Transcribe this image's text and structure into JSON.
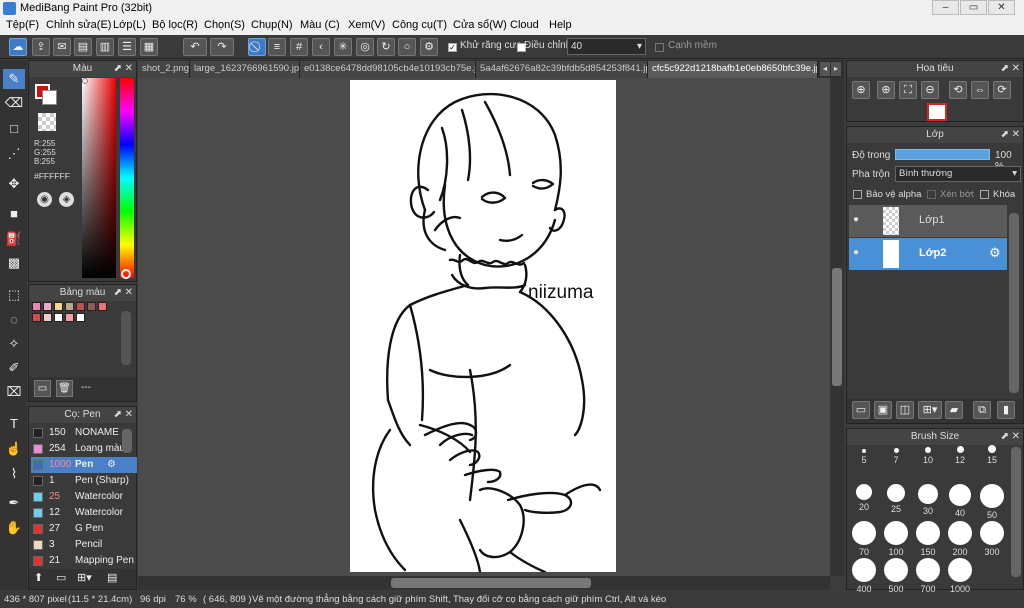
{
  "title": "MediBang Paint Pro (32bit)",
  "window_buttons": {
    "min": "–",
    "max": "▭",
    "close": "✕"
  },
  "menu": [
    "Tệp(F)",
    "Chỉnh sửa(E)",
    "Lớp(L)",
    "Bộ lọc(R)",
    "Chọn(S)",
    "Chụp(N)",
    "Màu (C)",
    "Xem(V)",
    "Công cụ(T)",
    "Cửa sổ(W)",
    "Cloud",
    "Help"
  ],
  "toolbar": {
    "antialias_label": "Khử răng cưa",
    "adjust_label": "Điều chỉnh",
    "adjust_value": "40",
    "edge_label": "Cạnh mềm"
  },
  "color_panel": {
    "title": "Màu",
    "rgb_r": "R:255",
    "rgb_g": "G:255",
    "rgb_b": "B:255",
    "hex": "#FFFFFF"
  },
  "swatch_panel": {
    "title": "Bảng màu",
    "footer": "---",
    "swatches": [
      "#e887b4",
      "#f4a6c8",
      "#f5d38a",
      "#b9a88b",
      "#c0504d",
      "#8e5a5a",
      "#e87474",
      "#d64a4a",
      "#f6c8d0",
      "#ffffff",
      "#f5a0a0",
      "#ffffff"
    ]
  },
  "brush_panel": {
    "title": "Cọ: Pen",
    "items": [
      {
        "size": "150",
        "name": "NONAME",
        "color": "#222222"
      },
      {
        "size": "254",
        "name": "Loang màu",
        "color": "#e98bd6"
      },
      {
        "size": "1000",
        "name": "Pen",
        "color": "#3a6fb5"
      },
      {
        "size": "1",
        "name": "Pen (Sharp)",
        "color": "#222222"
      },
      {
        "size": "25",
        "name": "Watercolor",
        "color": "#6ad0e8"
      },
      {
        "size": "12",
        "name": "Watercolor",
        "color": "#6ad0e8"
      },
      {
        "size": "27",
        "name": "G Pen",
        "color": "#e03434"
      },
      {
        "size": "3",
        "name": "Pencil",
        "color": "#f0d8c0"
      },
      {
        "size": "21",
        "name": "Mapping Pen",
        "color": "#e03434"
      }
    ]
  },
  "tabs": [
    "shot_2.png",
    "large_1623766961590.jpg",
    "e0138ce6478dd98105cb4e10193cb75e.jpg",
    "5a4af62676a82c39bfdb5d854253f841.jpg",
    "cfc5c922d1218bafb1e0eb8650bfc39e.jpg"
  ],
  "navigator": {
    "title": "Hoa tiêu"
  },
  "layer_panel": {
    "title": "Lớp",
    "opacity_label": "Độ trong",
    "opacity_value": "100 %",
    "blend_label": "Pha trộn",
    "blend_value": "Bình thường",
    "protect_alpha": "Bảo vệ alpha",
    "clipping": "Xén bớt",
    "lock": "Khóa",
    "layers": [
      "Lớp1",
      "Lớp2"
    ]
  },
  "brush_size": {
    "title": "Brush Size",
    "sizes": [
      "5",
      "7",
      "10",
      "12",
      "15",
      "20",
      "25",
      "30",
      "40",
      "50",
      "70",
      "100",
      "150",
      "200",
      "300",
      "400",
      "500",
      "700",
      "1000"
    ]
  },
  "canvas_text": "niizuma",
  "status": {
    "size": "436 * 807 pixel",
    "cm": "(11.5 * 21.4cm)",
    "dpi": "96 dpi",
    "zoom": "76 %",
    "coords": "( 646, 809 )",
    "hint": "Vẽ một đường thẳng bằng cách giữ phím Shift, Thay đổi cỡ cọ bằng cách giữ phím Ctrl, Alt và kéo"
  }
}
